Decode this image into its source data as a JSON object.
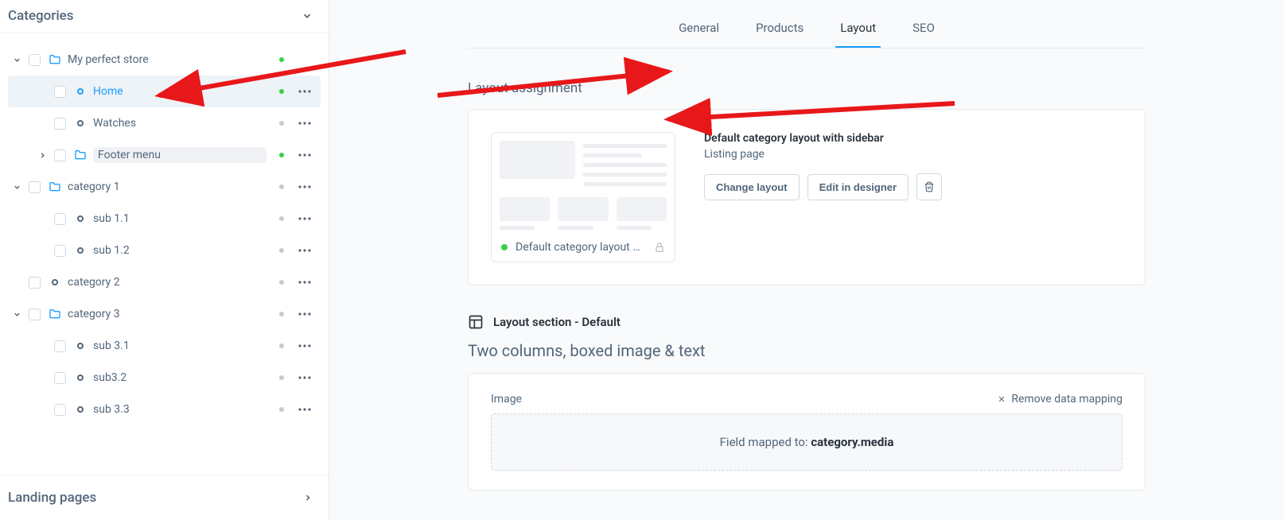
{
  "sidebar": {
    "categories_title": "Categories",
    "landing_title": "Landing pages",
    "tree": {
      "my_perfect_store": "My perfect store",
      "home": "Home",
      "watches": "Watches",
      "footer_menu": "Footer menu",
      "category_1": "category 1",
      "sub_1_1": "sub 1.1",
      "sub_1_2": "sub 1.2",
      "category_2": "category 2",
      "category_3": "category 3",
      "sub_3_1": "sub 3.1",
      "sub_3_2": "sub3.2",
      "sub_3_3": "sub 3.3"
    }
  },
  "tabs": {
    "general": "General",
    "products": "Products",
    "layout": "Layout",
    "seo": "SEO"
  },
  "layout_assignment": {
    "heading": "Layout assignment",
    "title": "Default category layout with sidebar",
    "subtitle": "Listing page",
    "change_layout": "Change layout",
    "edit_in_designer": "Edit in designer",
    "preview_caption": "Default category layout with …"
  },
  "layout_section": {
    "label": "Layout section - Default",
    "heading": "Two columns, boxed image & text",
    "field_label": "Image",
    "remove_mapping": "Remove data mapping",
    "mapped_prefix": "Field mapped to: ",
    "mapped_field": "category.media"
  }
}
